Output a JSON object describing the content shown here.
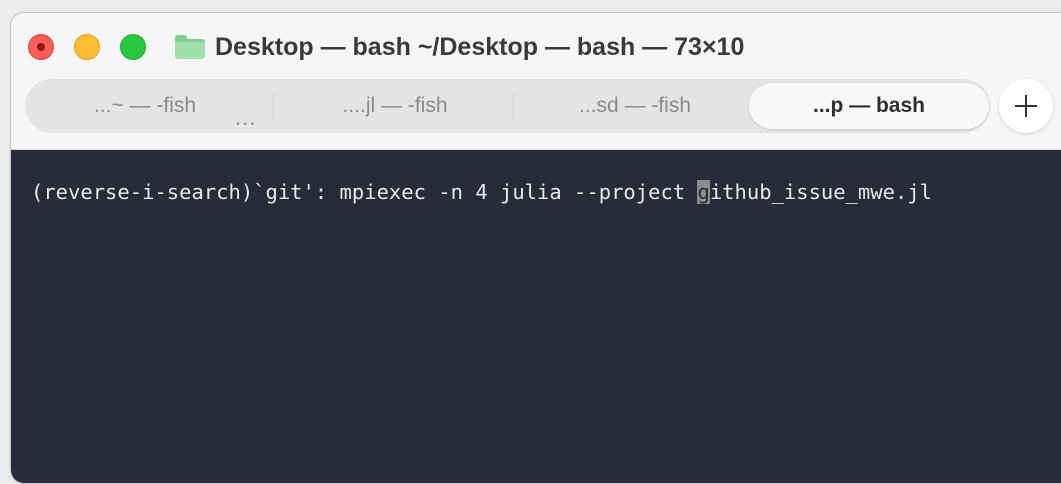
{
  "window": {
    "title": "Desktop — bash ~/Desktop — bash — 73×10"
  },
  "tabs": [
    {
      "label": "...~ — -fish",
      "active": false
    },
    {
      "label": "....jl — -fish",
      "active": false
    },
    {
      "label": "...sd — -fish",
      "active": false
    },
    {
      "label": "...p — bash",
      "active": true
    }
  ],
  "tab_overflow": "...",
  "terminal": {
    "prefix": "(reverse-i-search)`git': mpiexec -n 4 julia --project ",
    "cursor_char": "g",
    "suffix": "ithub_issue_mwe.jl"
  },
  "colors": {
    "close": "#ff5f57",
    "minimize": "#febc2e",
    "zoom": "#28c840",
    "terminal_bg": "#272c38",
    "folder": "#9fe0ad"
  },
  "icons": {
    "title_icon": "folder-icon",
    "new_tab_icon": "plus-icon"
  }
}
